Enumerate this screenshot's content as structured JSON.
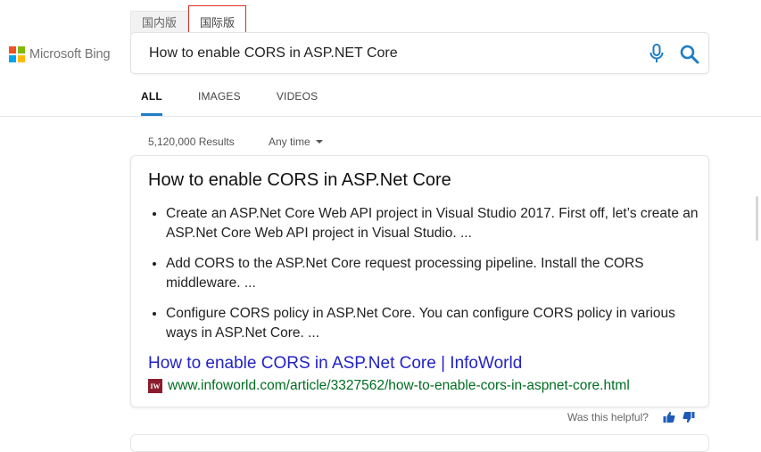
{
  "logo": {
    "text": "Microsoft Bing",
    "colors": [
      "#f25022",
      "#7fba00",
      "#00a4ef",
      "#ffb900"
    ]
  },
  "region_tabs": [
    {
      "label": "国内版",
      "active": false
    },
    {
      "label": "国际版",
      "active": true
    }
  ],
  "search": {
    "query": "How to enable CORS in ASP.NET Core",
    "icons": {
      "mic": "mic-icon",
      "search": "search-icon"
    },
    "accent_color": "#1e7ec8"
  },
  "scope_tabs": [
    {
      "label": "ALL",
      "active": true
    },
    {
      "label": "IMAGES",
      "active": false
    },
    {
      "label": "VIDEOS",
      "active": false
    }
  ],
  "results_meta": {
    "count": "5,120,000 Results",
    "time_filter": "Any time"
  },
  "answer_card": {
    "title": "How to enable CORS in ASP.Net Core",
    "bullets": [
      "Create an ASP.Net Core Web API project in Visual Studio 2017. First off, let’s create an ASP.Net Core Web API project in Visual Studio. ...",
      "Add CORS to the ASP.Net Core request processing pipeline. Install the CORS middleware. ...",
      "Configure CORS policy in ASP.Net Core. You can configure CORS policy in various ways in ASP.Net Core. ..."
    ],
    "link_title": "How to enable CORS in ASP.Net Core | InfoWorld",
    "favicon_text": "IW",
    "url": "www.infoworld.com/article/3327562/how-to-enable-cors-in-aspnet-core.html",
    "link_color": "#2222c7",
    "url_color": "#006d21"
  },
  "feedback": {
    "label": "Was this helpful?",
    "icons": [
      "thumbs-up-icon",
      "thumbs-down-icon"
    ],
    "color": "#1e5bb8"
  }
}
